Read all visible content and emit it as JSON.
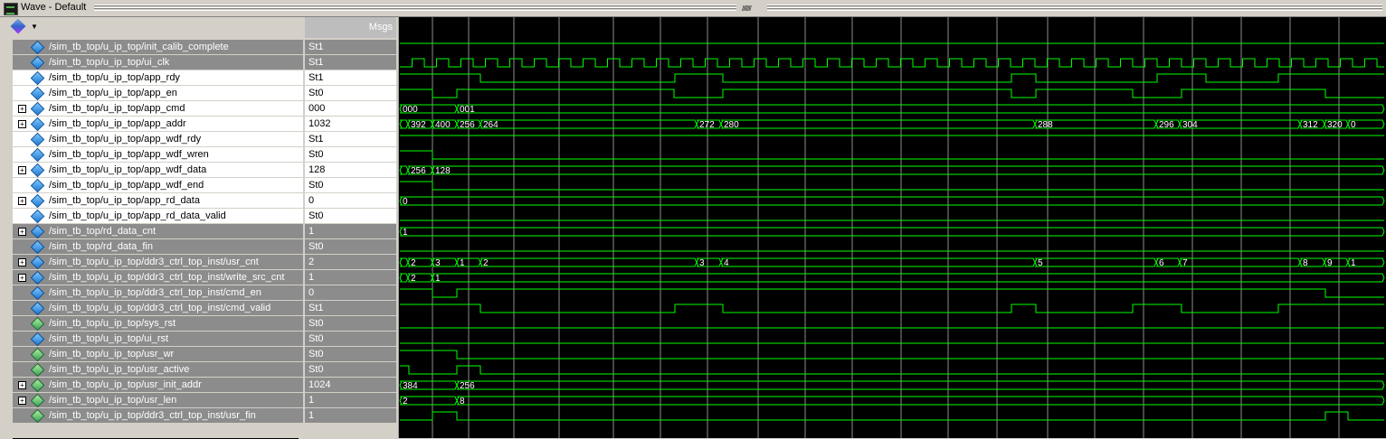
{
  "window": {
    "title": "Wave - Default"
  },
  "header": {
    "msgs_label": "Msgs"
  },
  "colors": {
    "wave": "#00ff00",
    "background": "#000000",
    "grid": "#ffffff",
    "label": "#ffffff",
    "icon_blue": "#1e78d0",
    "icon_green": "#3aa05a"
  },
  "signals": [
    {
      "name": "/sim_tb_top/u_ip_top/init_calib_complete",
      "value": "St1",
      "expandable": false,
      "icon": "signal-icon",
      "style": "grey",
      "wave": {
        "type": "bit",
        "init": 1,
        "edges": []
      }
    },
    {
      "name": "/sim_tb_top/u_ip_top/ui_clk",
      "value": "St1",
      "expandable": false,
      "icon": "signal-icon",
      "style": "grey",
      "wave": {
        "type": "clock",
        "init": 0,
        "period": 27,
        "start": 0
      }
    },
    {
      "name": "/sim_tb_top/u_ip_top/app_rdy",
      "value": "St1",
      "expandable": false,
      "icon": "signal-icon",
      "style": "sel",
      "wave": {
        "type": "bit",
        "init": 1,
        "edges": [
          91,
          306,
          359,
          678,
          705,
          839,
          893,
          973
        ]
      }
    },
    {
      "name": "/sim_tb_top/u_ip_top/app_en",
      "value": "St0",
      "expandable": false,
      "icon": "signal-icon",
      "style": "sel",
      "wave": {
        "type": "bit",
        "init": 1,
        "edges": [
          38,
          65,
          305,
          359,
          678,
          705,
          812,
          866,
          1025
        ]
      }
    },
    {
      "name": "/sim_tb_top/u_ip_top/app_cmd",
      "value": "000",
      "expandable": true,
      "icon": "bus-icon",
      "style": "sel",
      "wave": {
        "type": "bus",
        "segments": [
          {
            "t": 0,
            "v": "000"
          },
          {
            "t": 65,
            "v": "001"
          }
        ]
      }
    },
    {
      "name": "/sim_tb_top/u_ip_top/app_addr",
      "value": "1032",
      "expandable": true,
      "icon": "bus-icon",
      "style": "sel",
      "wave": {
        "type": "bus",
        "segments": [
          {
            "t": 0,
            "v": ""
          },
          {
            "t": 11,
            "v": "392"
          },
          {
            "t": 38,
            "v": "400"
          },
          {
            "t": 65,
            "v": "256"
          },
          {
            "t": 91,
            "v": "264"
          },
          {
            "t": 330,
            "v": "272"
          },
          {
            "t": 357,
            "v": "280"
          },
          {
            "t": 704,
            "v": "288"
          },
          {
            "t": 838,
            "v": "296"
          },
          {
            "t": 864,
            "v": "304"
          },
          {
            "t": 997,
            "v": "312"
          },
          {
            "t": 1024,
            "v": "320"
          },
          {
            "t": 1050,
            "v": "0"
          }
        ]
      }
    },
    {
      "name": "/sim_tb_top/u_ip_top/app_wdf_rdy",
      "value": "St1",
      "expandable": false,
      "icon": "signal-icon",
      "style": "sel",
      "wave": {
        "type": "bit",
        "init": 1,
        "edges": []
      }
    },
    {
      "name": "/sim_tb_top/u_ip_top/app_wdf_wren",
      "value": "St0",
      "expandable": false,
      "icon": "signal-icon",
      "style": "sel",
      "wave": {
        "type": "bit",
        "init": 1,
        "edges": [
          38
        ]
      }
    },
    {
      "name": "/sim_tb_top/u_ip_top/app_wdf_data",
      "value": "128",
      "expandable": true,
      "icon": "bus-icon",
      "style": "sel",
      "wave": {
        "type": "bus",
        "segments": [
          {
            "t": 0,
            "v": ""
          },
          {
            "t": 11,
            "v": "256"
          },
          {
            "t": 38,
            "v": "128"
          }
        ]
      }
    },
    {
      "name": "/sim_tb_top/u_ip_top/app_wdf_end",
      "value": "St0",
      "expandable": false,
      "icon": "signal-icon",
      "style": "sel",
      "wave": {
        "type": "bit",
        "init": 1,
        "edges": [
          38
        ]
      }
    },
    {
      "name": "/sim_tb_top/u_ip_top/app_rd_data",
      "value": "0",
      "expandable": true,
      "icon": "bus-icon",
      "style": "sel",
      "wave": {
        "type": "bus",
        "segments": [
          {
            "t": 0,
            "v": "0"
          }
        ]
      }
    },
    {
      "name": "/sim_tb_top/u_ip_top/app_rd_data_valid",
      "value": "St0",
      "expandable": false,
      "icon": "signal-icon",
      "style": "sel",
      "wave": {
        "type": "bit",
        "init": 0,
        "edges": []
      }
    },
    {
      "name": "/sim_tb_top/rd_data_cnt",
      "value": "1",
      "expandable": true,
      "icon": "bus-icon",
      "style": "grey",
      "wave": {
        "type": "bus",
        "segments": [
          {
            "t": 0,
            "v": "1"
          }
        ]
      }
    },
    {
      "name": "/sim_tb_top/rd_data_fin",
      "value": "St0",
      "expandable": false,
      "icon": "signal-icon",
      "style": "grey",
      "wave": {
        "type": "bit",
        "init": 0,
        "edges": []
      }
    },
    {
      "name": "/sim_tb_top/u_ip_top/ddr3_ctrl_top_inst/usr_cnt",
      "value": "2",
      "expandable": true,
      "icon": "bus-icon",
      "style": "grey",
      "wave": {
        "type": "bus",
        "segments": [
          {
            "t": 0,
            "v": ""
          },
          {
            "t": 11,
            "v": "2"
          },
          {
            "t": 38,
            "v": "3"
          },
          {
            "t": 65,
            "v": "1"
          },
          {
            "t": 91,
            "v": "2"
          },
          {
            "t": 330,
            "v": "3"
          },
          {
            "t": 357,
            "v": "4"
          },
          {
            "t": 704,
            "v": "5"
          },
          {
            "t": 838,
            "v": "6"
          },
          {
            "t": 864,
            "v": "7"
          },
          {
            "t": 997,
            "v": "8"
          },
          {
            "t": 1024,
            "v": "9"
          },
          {
            "t": 1050,
            "v": "1"
          }
        ]
      }
    },
    {
      "name": "/sim_tb_top/u_ip_top/ddr3_ctrl_top_inst/write_src_cnt",
      "value": "1",
      "expandable": true,
      "icon": "bus-icon",
      "style": "grey",
      "wave": {
        "type": "bus",
        "segments": [
          {
            "t": 0,
            "v": ""
          },
          {
            "t": 11,
            "v": "2"
          },
          {
            "t": 38,
            "v": "1"
          }
        ]
      }
    },
    {
      "name": "/sim_tb_top/u_ip_top/ddr3_ctrl_top_inst/cmd_en",
      "value": "0",
      "expandable": false,
      "icon": "signal-icon",
      "style": "grey",
      "wave": {
        "type": "bit",
        "init": 1,
        "edges": [
          38,
          65,
          1025
        ]
      }
    },
    {
      "name": "/sim_tb_top/u_ip_top/ddr3_ctrl_top_inst/cmd_valid",
      "value": "St1",
      "expandable": false,
      "icon": "signal-icon",
      "style": "grey",
      "wave": {
        "type": "bit",
        "init": 1,
        "edges": [
          91,
          306,
          359,
          678,
          705,
          812,
          866,
          973
        ]
      }
    },
    {
      "name": "/sim_tb_top/u_ip_top/sys_rst",
      "value": "St0",
      "expandable": false,
      "icon": "in-icon",
      "style": "grey",
      "wave": {
        "type": "bit",
        "init": 0,
        "edges": []
      }
    },
    {
      "name": "/sim_tb_top/u_ip_top/ui_rst",
      "value": "St0",
      "expandable": false,
      "icon": "signal-icon",
      "style": "grey",
      "wave": {
        "type": "bit",
        "init": 0,
        "edges": []
      }
    },
    {
      "name": "/sim_tb_top/u_ip_top/usr_wr",
      "value": "St0",
      "expandable": false,
      "icon": "in-icon",
      "style": "grey",
      "wave": {
        "type": "bit",
        "init": 1,
        "edges": [
          65
        ]
      }
    },
    {
      "name": "/sim_tb_top/u_ip_top/usr_active",
      "value": "St0",
      "expandable": false,
      "icon": "in-icon",
      "style": "grey",
      "wave": {
        "type": "bit",
        "init": 1,
        "edges": [
          12,
          65,
          91
        ]
      }
    },
    {
      "name": "/sim_tb_top/u_ip_top/usr_init_addr",
      "value": "1024",
      "expandable": true,
      "icon": "in-bus-icon",
      "style": "grey",
      "wave": {
        "type": "bus",
        "segments": [
          {
            "t": 0,
            "v": "384"
          },
          {
            "t": 65,
            "v": "256"
          }
        ]
      }
    },
    {
      "name": "/sim_tb_top/u_ip_top/usr_len",
      "value": "1",
      "expandable": true,
      "icon": "in-bus-icon",
      "style": "grey",
      "wave": {
        "type": "bus",
        "segments": [
          {
            "t": 0,
            "v": "2"
          },
          {
            "t": 65,
            "v": "8"
          }
        ]
      }
    },
    {
      "name": "/sim_tb_top/u_ip_top/ddr3_ctrl_top_inst/usr_fin",
      "value": "1",
      "expandable": false,
      "icon": "in-icon",
      "style": "grey",
      "wave": {
        "type": "bit",
        "init": 0,
        "edges": [
          38,
          65,
          1025,
          1050
        ]
      }
    }
  ],
  "gridlines": [
    38,
    78,
    128,
    178,
    238,
    290,
    342,
    398,
    450,
    502,
    556,
    608,
    662,
    718,
    770,
    824,
    878,
    932,
    986,
    1040
  ]
}
